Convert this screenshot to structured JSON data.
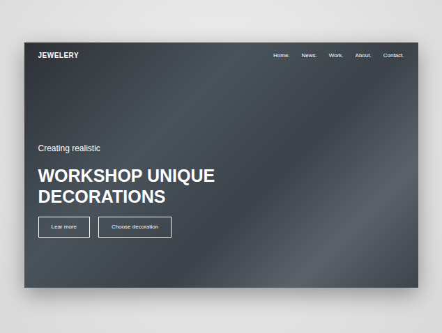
{
  "nav": {
    "logo": "JEWELERY",
    "items": [
      "Home.",
      "News.",
      "Work.",
      "About.",
      "Contact."
    ]
  },
  "hero": {
    "subtitle": "Creating realistic",
    "heading_lines": [
      "WORKSHOP UNIQUE",
      "DECORATIONS"
    ],
    "buttons": [
      "Lear more",
      "Choose decoration"
    ]
  }
}
